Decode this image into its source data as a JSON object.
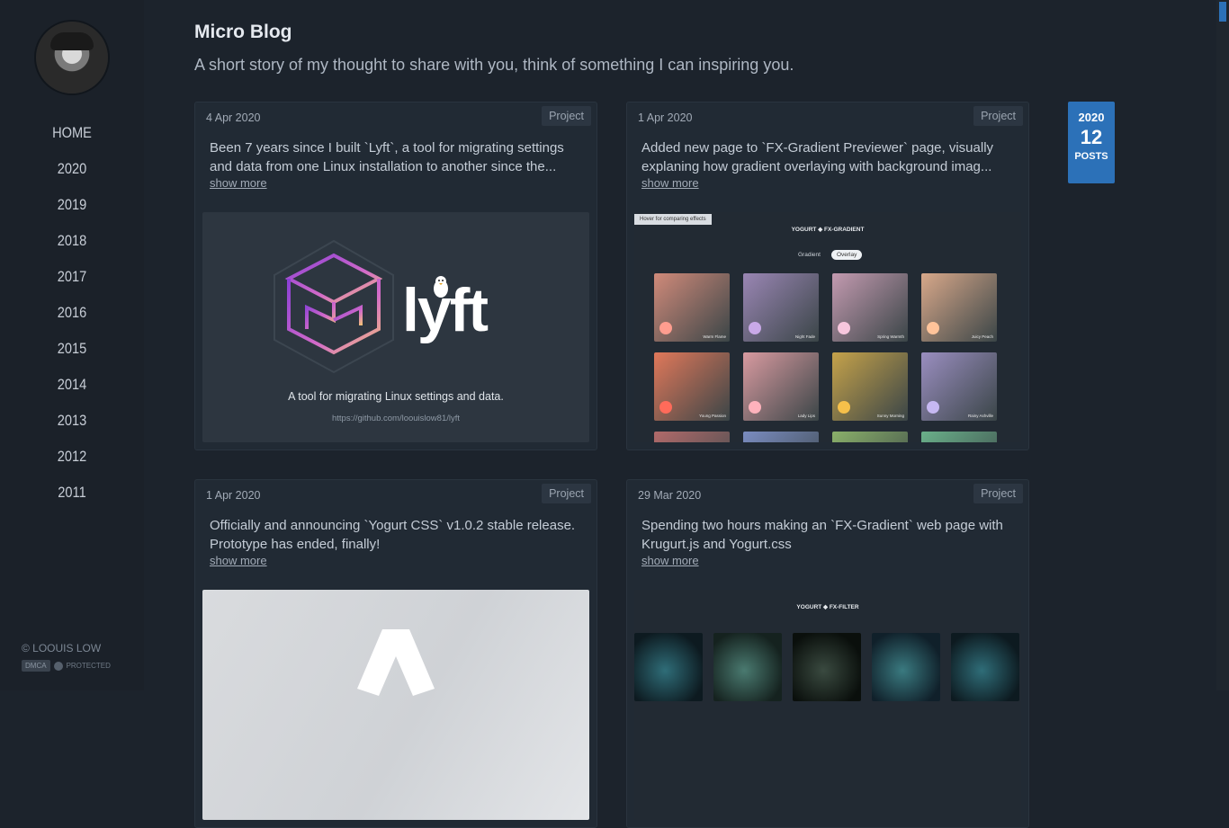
{
  "sidebar": {
    "nav": [
      "HOME",
      "2020",
      "2019",
      "2018",
      "2017",
      "2016",
      "2015",
      "2014",
      "2013",
      "2012",
      "2011"
    ],
    "copyright": "© LOOUIS LOW",
    "dmca": {
      "left": "DMCA",
      "right": "PROTECTED"
    }
  },
  "header": {
    "title": "Micro Blog",
    "subtitle": "A short story of my thought to share with you, think of something I can inspiring you."
  },
  "badge": {
    "year": "2020",
    "count": "12",
    "label": "POSTS"
  },
  "posts": [
    {
      "date": "4 Apr 2020",
      "tag": "Project",
      "text": "Been 7 years since I built `Lyft`, a tool for migrating settings and data from one Linux installation to another since the...",
      "more": "show more",
      "media": {
        "word": "lyft",
        "caption": "A tool for migrating Linux settings and data.",
        "url": "https://github.com/loouislow81/lyft"
      }
    },
    {
      "date": "1 Apr 2020",
      "tag": "Project",
      "text": "Added new page to `FX-Gradient Previewer` page, visually explaning how gradient overlaying with background imag...",
      "more": "show more",
      "media": {
        "label": "Hover for comparing effects",
        "brand": "YOGURT ◆ FX-GRADIENT",
        "tabs": [
          "Gradient",
          "Overlay"
        ],
        "thumbs": [
          "Warm Flame",
          "Night Fade",
          "Spring Warmth",
          "Juicy Peach",
          "Young Passion",
          "Lady Lips",
          "Sunny Morning",
          "Rainy Ashville"
        ]
      }
    },
    {
      "date": "1 Apr 2020",
      "tag": "Project",
      "text": "Officially and announcing `Yogurt CSS` v1.0.2 stable release. Prototype has ended, finally!",
      "more": "show more"
    },
    {
      "date": "29 Mar 2020",
      "tag": "Project",
      "text": "Spending two hours making an `FX-Gradient` web page with Krugurt.js and Yogurt.css",
      "more": "show more",
      "media": {
        "brand": "YOGURT ◆ FX-FILTER"
      }
    }
  ],
  "colors": {
    "accent": "#2c71b8",
    "background": "#1c232c",
    "card": "#212a34"
  }
}
